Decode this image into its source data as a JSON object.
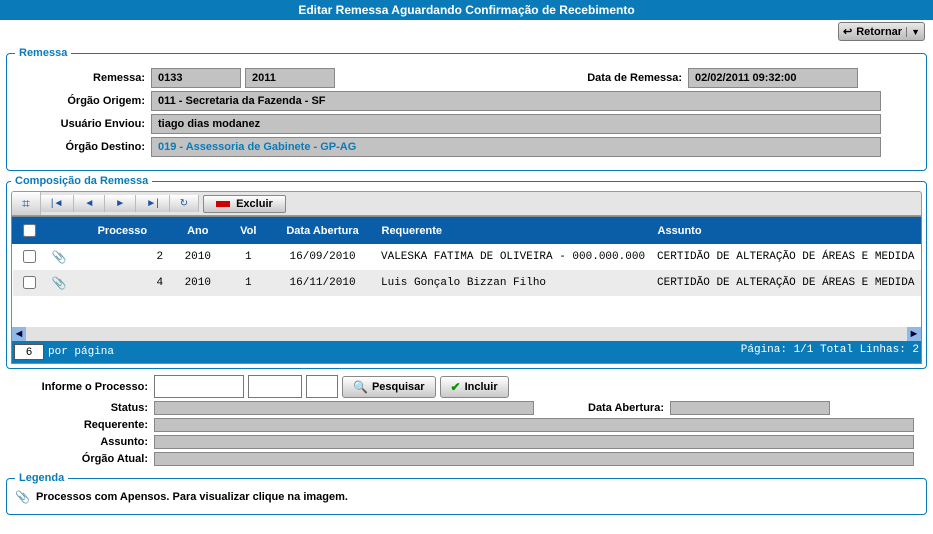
{
  "titlebar": "Editar Remessa Aguardando Confirmação de Recebimento",
  "btn": {
    "retornar": "Retornar",
    "excluir": "Excluir",
    "pesquisar": "Pesquisar",
    "incluir": "Incluir"
  },
  "remessa": {
    "legend": "Remessa",
    "labels": {
      "remessa": "Remessa:",
      "data": "Data de Remessa:",
      "origem": "Órgão Origem:",
      "usuario": "Usuário Enviou:",
      "destino": "Órgão Destino:"
    },
    "num": "0133",
    "ano": "2011",
    "data": "02/02/2011 09:32:00",
    "origem": "011 - Secretaria da Fazenda - SF",
    "usuario": "tiago dias modanez",
    "destino": "019 - Assessoria de Gabinete - GP-AG"
  },
  "comp": {
    "legend": "Composição da Remessa",
    "cols": {
      "processo": "Processo",
      "ano": "Ano",
      "vol": "Vol",
      "abertura": "Data Abertura",
      "requerente": "Requerente",
      "assunto": "Assunto"
    },
    "rows": [
      {
        "processo": "2",
        "ano": "2010",
        "vol": "1",
        "abertura": "16/09/2010",
        "requerente": "VALESKA FATIMA DE OLIVEIRA - 000.000.000",
        "assunto": "CERTIDÃO DE ALTERAÇÃO DE ÁREAS E MEDIDA"
      },
      {
        "processo": "4",
        "ano": "2010",
        "vol": "1",
        "abertura": "16/11/2010",
        "requerente": "Luis Gonçalo Bizzan Filho",
        "assunto": "CERTIDÃO DE ALTERAÇÃO DE ÁREAS E MEDIDA"
      }
    ],
    "per_page_label": "por página",
    "per_page": "6",
    "footer_right": "Página: 1/1 Total Linhas: 2"
  },
  "inform": {
    "labels": {
      "processo": "Informe o Processo:",
      "status": "Status:",
      "abertura": "Data Abertura:",
      "requerente": "Requerente:",
      "assunto": "Assunto:",
      "orgao": "Órgão Atual:"
    }
  },
  "legenda": {
    "legend": "Legenda",
    "text": "Processos com Apensos. Para visualizar clique na imagem."
  }
}
